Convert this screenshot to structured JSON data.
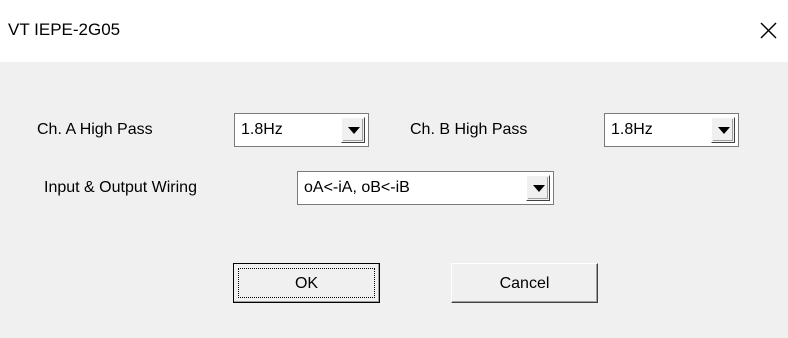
{
  "window": {
    "title": "VT IEPE-2G05",
    "close_icon": "close-icon"
  },
  "form": {
    "ch_a": {
      "label": "Ch. A High Pass",
      "value": "1.8Hz"
    },
    "ch_b": {
      "label": "Ch. B High Pass",
      "value": "1.8Hz"
    },
    "wiring": {
      "label": "Input & Output Wiring",
      "value": "oA<-iA, oB<-iB"
    }
  },
  "buttons": {
    "ok": "OK",
    "cancel": "Cancel"
  },
  "colors": {
    "title_bg": "#ffffff",
    "client_bg": "#f0f0f0"
  }
}
